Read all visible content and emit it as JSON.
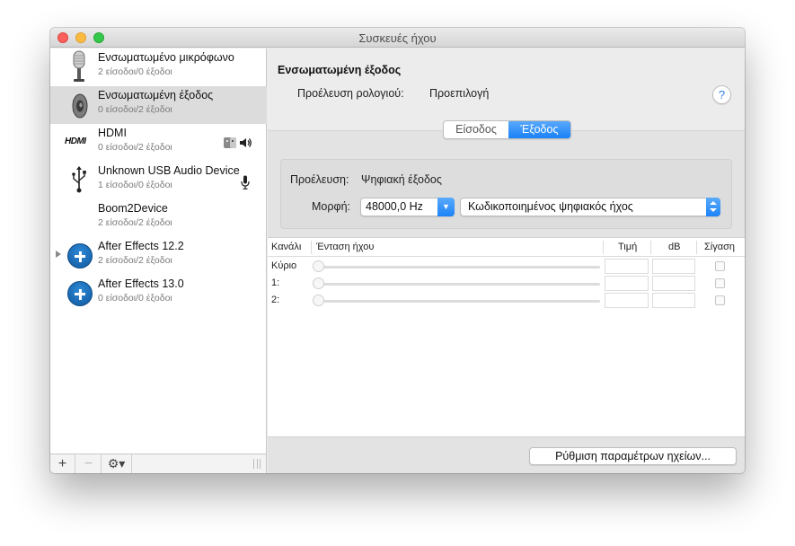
{
  "window": {
    "title": "Συσκευές ήχου"
  },
  "devices": [
    {
      "name": "Ενσωματωμένο μικρόφωνο",
      "io": "2 είσοδοι/0 έξοδοι",
      "icon": "microphone-icon"
    },
    {
      "name": "Ενσωματωμένη έξοδος",
      "io": "0 είσοδοι/2 έξοδοι",
      "icon": "speaker-icon",
      "selected": true
    },
    {
      "name": "HDMI",
      "io": "0 είσοδοι/2 έξοδοι",
      "icon": "hdmi-icon",
      "logo_text": "HDMI"
    },
    {
      "name": "Unknown USB Audio Device",
      "io": "1 είσοδοι/0 έξοδοι",
      "icon": "usb-icon"
    },
    {
      "name": "Boom2Device",
      "io": "2 είσοδοι/2 έξοδοι"
    },
    {
      "name": "After Effects 12.2",
      "io": "2 είσοδοι/2 έξοδοι",
      "icon": "plus-circle-icon"
    },
    {
      "name": "After Effects 13.0",
      "io": "0 είσοδοι/0 έξοδοι",
      "icon": "plus-circle-icon"
    }
  ],
  "sidebar_footer": {
    "add": "+",
    "remove": "−",
    "gear_label": "⚙︎▾"
  },
  "detail": {
    "title": "Ενσωματωμένη έξοδος",
    "clock_label": "Προέλευση ρολογιού:",
    "clock_value": "Προεπιλογή",
    "help": "?",
    "tabs": [
      {
        "label": "Είσοδος"
      },
      {
        "label": "Έξοδος",
        "active": true
      }
    ],
    "source_label": "Προέλευση:",
    "source_value": "Ψηφιακή έξοδος",
    "format_label": "Μορφή:",
    "format_rate": "48000,0 Hz",
    "format_type": "Κωδικοποιημένος ψηφιακός ήχος",
    "table": {
      "headers": {
        "channel": "Κανάλι",
        "volume": "Ένταση ήχου",
        "value": "Τιμή",
        "db": "dB",
        "mute": "Σίγαση"
      },
      "rows": [
        {
          "channel": "Κύριο"
        },
        {
          "channel": "1:"
        },
        {
          "channel": "2:"
        }
      ]
    },
    "configure_button": "Ρύθμιση παραμέτρων ηχείων..."
  },
  "colors": {
    "accent": "#1a82f7",
    "selection": "#dcdcdc",
    "plus_icon": "#1a6fc0"
  }
}
